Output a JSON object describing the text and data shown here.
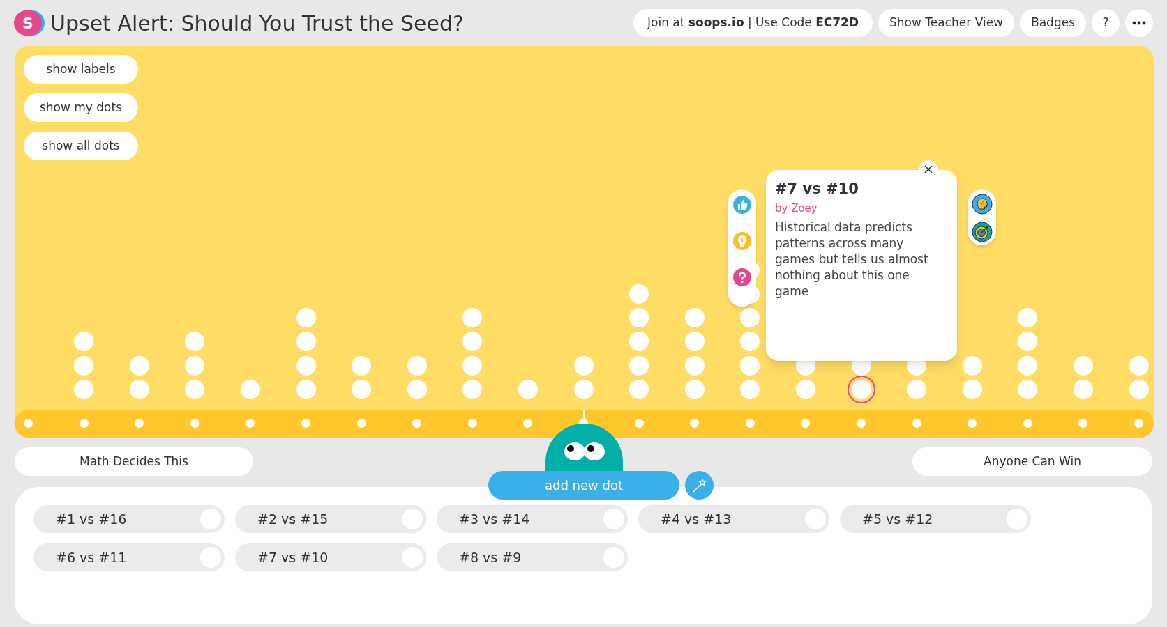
{
  "header": {
    "logo": "S",
    "title": "Upset Alert: Should You Trust the Seed?",
    "join": "Join at **soops.io** | Use Code **EC72D**",
    "buttons": [
      "Show Teacher View",
      "Badges",
      "?"
    ]
  },
  "toggles": [
    "show labels",
    "show my dots",
    "show all dots"
  ],
  "plot": {
    "columns": [
      {},
      {
        "dots": [
          {
            "selected": false
          },
          {
            "selected": false
          },
          {
            "selected": false
          }
        ]
      },
      {
        "dots": [
          {
            "selected": false
          },
          {
            "selected": false
          }
        ]
      },
      {
        "dots": [
          {
            "selected": false
          },
          {
            "selected": false
          },
          {
            "selected": false
          }
        ]
      },
      {
        "dots": [
          {
            "selected": false
          }
        ]
      },
      {
        "dots": [
          {
            "selected": false
          },
          {
            "selected": false
          },
          {
            "selected": false
          },
          {
            "selected": false
          }
        ]
      },
      {
        "dots": [
          {
            "selected": false
          },
          {
            "selected": false
          }
        ]
      },
      {
        "dots": [
          {
            "selected": false
          },
          {
            "selected": false
          }
        ]
      },
      {
        "dots": [
          {
            "selected": false
          },
          {
            "selected": false
          },
          {
            "selected": false
          },
          {
            "selected": false
          }
        ]
      },
      {
        "dots": [
          {
            "selected": false
          }
        ]
      },
      {
        "dots": [
          {
            "selected": false
          },
          {
            "selected": false
          }
        ]
      },
      {
        "dots": [
          {
            "selected": false
          },
          {
            "selected": false
          },
          {
            "selected": false
          },
          {
            "selected": false
          },
          {
            "selected": false
          }
        ]
      },
      {
        "dots": [
          {
            "selected": false
          },
          {
            "selected": false
          },
          {
            "selected": false
          },
          {
            "selected": false
          }
        ]
      },
      {
        "dots": [
          {
            "selected": false
          },
          {
            "selected": false
          },
          {
            "selected": false
          },
          {
            "selected": false
          },
          {
            "selected": false
          },
          {
            "selected": false
          }
        ]
      },
      {
        "dots": [
          {
            "selected": false
          },
          {
            "selected": false
          }
        ]
      },
      {
        "dots": [
          {
            "selected": true
          },
          {
            "selected": false
          }
        ]
      },
      {
        "dots": [
          {
            "selected": false
          },
          {
            "selected": false
          }
        ]
      },
      {
        "dots": [
          {
            "selected": false
          },
          {
            "selected": false
          }
        ]
      },
      {
        "dots": [
          {
            "selected": false
          },
          {
            "selected": false
          },
          {
            "selected": false
          },
          {
            "selected": false
          }
        ]
      },
      {
        "dots": [
          {
            "selected": false
          },
          {
            "selected": false
          }
        ]
      },
      {
        "dots": [
          {
            "selected": false
          },
          {
            "selected": false
          }
        ]
      }
    ]
  },
  "card": {
    "title": "#7 vs #10",
    "author": "by Zoey",
    "text": "Historical data predicts patterns across many games but tells us almost nothing about this one game"
  },
  "scale": {
    "left": "Math Decides This",
    "right": "Anyone Can Win"
  },
  "add_button": "add new dot",
  "chips": [
    {
      "label": "#1 vs #16",
      "selected": false
    },
    {
      "label": "#2 vs #15",
      "selected": false
    },
    {
      "label": "#3 vs #14",
      "selected": false
    },
    {
      "label": "#4 vs #13",
      "selected": false
    },
    {
      "label": "#5 vs #12",
      "selected": false
    },
    {
      "label": "#6 vs #11",
      "selected": false
    },
    {
      "label": "#7 vs #10",
      "selected": false
    },
    {
      "label": "#8 vs #9",
      "selected": false
    }
  ]
}
